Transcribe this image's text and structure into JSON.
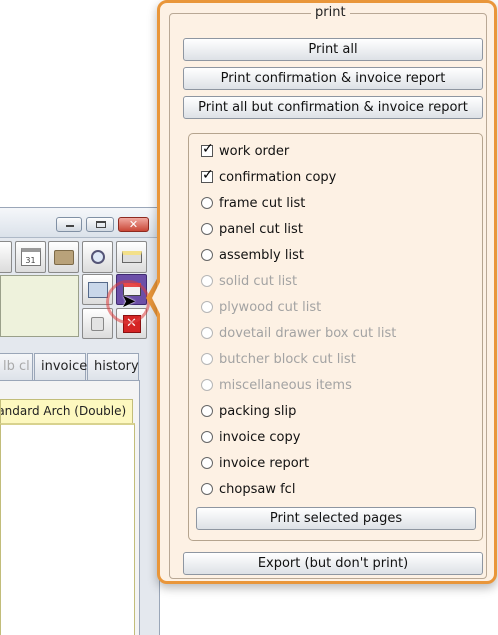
{
  "background_window": {
    "title_buttons": {
      "minimize": "–",
      "maximize": "□",
      "close": "✕"
    },
    "toolbar_calendar_day": "31",
    "tabs": [
      "lb cl",
      "invoice",
      "history"
    ],
    "sub_tab": "Standard Arch (Double)"
  },
  "print_popover": {
    "group_title": "print",
    "buttons": {
      "print_all": "Print all",
      "print_confirmation_invoice": "Print confirmation & invoice report",
      "print_all_but": "Print all but confirmation & invoice report",
      "print_selected": "Print selected pages",
      "export": "Export (but don't print)"
    },
    "pages": [
      {
        "label": "work order",
        "kind": "checkbox",
        "checked": true,
        "enabled": true
      },
      {
        "label": "confirmation copy",
        "kind": "checkbox",
        "checked": true,
        "enabled": true
      },
      {
        "label": "frame cut list",
        "kind": "radio",
        "checked": false,
        "enabled": true
      },
      {
        "label": "panel cut list",
        "kind": "radio",
        "checked": false,
        "enabled": true
      },
      {
        "label": "assembly list",
        "kind": "radio",
        "checked": false,
        "enabled": true
      },
      {
        "label": "solid cut list",
        "kind": "radio",
        "checked": false,
        "enabled": false
      },
      {
        "label": "plywood cut list",
        "kind": "radio",
        "checked": false,
        "enabled": false
      },
      {
        "label": "dovetail drawer box cut list",
        "kind": "radio",
        "checked": false,
        "enabled": false
      },
      {
        "label": "butcher block cut list",
        "kind": "radio",
        "checked": false,
        "enabled": false
      },
      {
        "label": "miscellaneous items",
        "kind": "radio",
        "checked": false,
        "enabled": false
      },
      {
        "label": "packing slip",
        "kind": "radio",
        "checked": false,
        "enabled": true
      },
      {
        "label": "invoice copy",
        "kind": "radio",
        "checked": false,
        "enabled": true
      },
      {
        "label": "invoice report",
        "kind": "radio",
        "checked": false,
        "enabled": true
      },
      {
        "label": "chopsaw fcl",
        "kind": "radio",
        "checked": false,
        "enabled": true
      }
    ]
  },
  "colors": {
    "popover_border": "#e9963a",
    "popover_bg": "#fdf1e4",
    "disabled_text": "#a3a3a3"
  }
}
